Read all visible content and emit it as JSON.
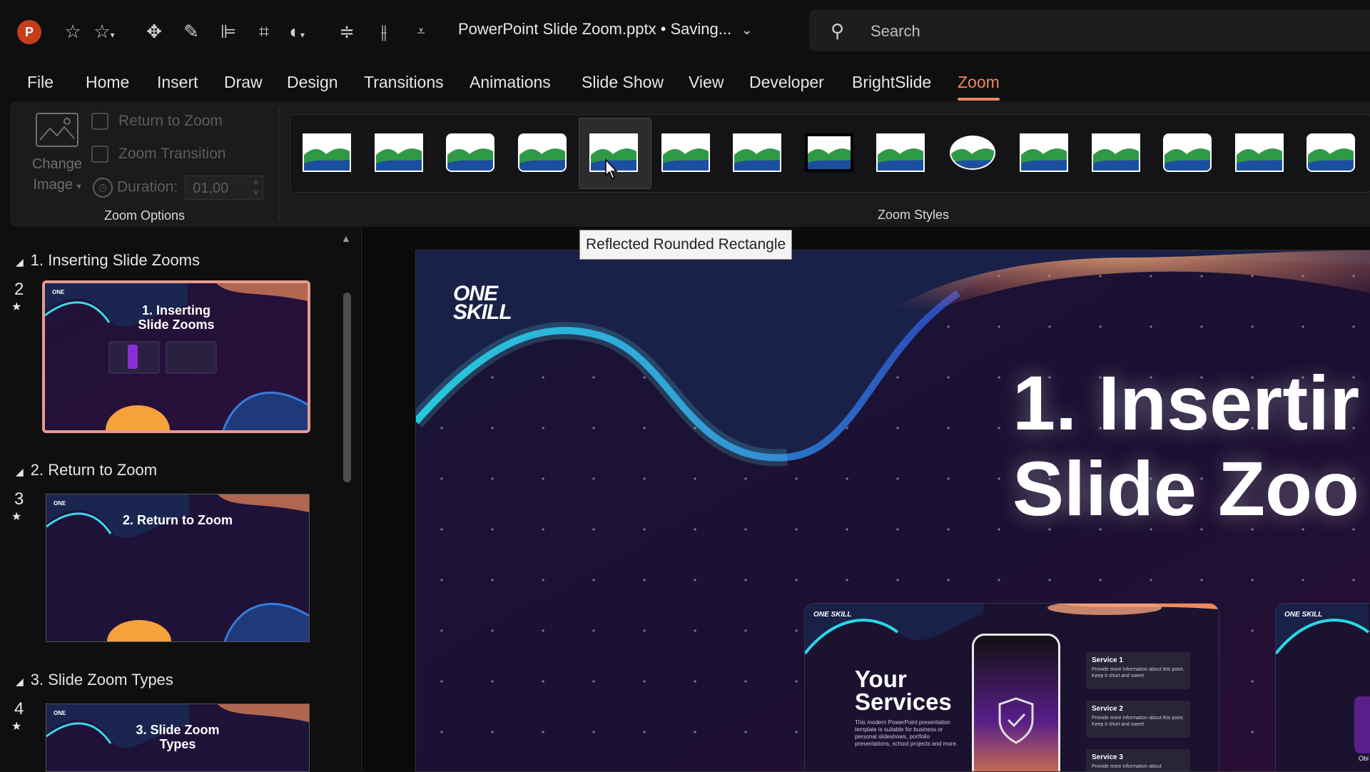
{
  "app": {
    "logo_letter": "P",
    "doc_title": "PowerPoint Slide Zoom.pptx • Saving...",
    "search_placeholder": "Search"
  },
  "quick_access_icons": [
    "auto-fit-icon",
    "star-icon",
    "move-icon",
    "stylus-icon",
    "align-icon",
    "crop-icon",
    "shape-icon",
    "distribute-horizontal-icon",
    "distribute-vertical-icon",
    "customize-icon"
  ],
  "tabs": [
    "File",
    "Home",
    "Insert",
    "Draw",
    "Design",
    "Transitions",
    "Animations",
    "Slide Show",
    "View",
    "Developer",
    "BrightSlide",
    "Zoom"
  ],
  "active_tab": "Zoom",
  "ribbon": {
    "change_image_label_1": "Change",
    "change_image_label_2": "Image",
    "return_to_zoom": "Return to Zoom",
    "zoom_transition": "Zoom Transition",
    "duration_label": "Duration:",
    "duration_value": "01,00",
    "zoom_options_label": "Zoom Options",
    "zoom_styles_label": "Zoom Styles",
    "style_count": 15,
    "hovered_style_index": 4
  },
  "tooltip": "Reflected Rounded Rectangle",
  "sections": [
    {
      "title": "1. Inserting Slide Zooms",
      "slide_number": "2",
      "thumb_title": "1. Inserting Slide Zooms",
      "selected": true
    },
    {
      "title": "2. Return to Zoom",
      "slide_number": "3",
      "thumb_title": "2. Return to Zoom",
      "selected": false
    },
    {
      "title": "3. Slide Zoom Types",
      "slide_number": "4",
      "thumb_title": "3. Slide Zoom Types",
      "selected": false
    }
  ],
  "slide": {
    "logo_line1": "ONE",
    "logo_line2": "SKILL",
    "title_line1": "1. Insertir",
    "title_line2": "Slide Zoo",
    "card": {
      "logo": "ONE SKILL",
      "title_line1": "Your",
      "title_line2": "Services",
      "description": "This modern PowerPoint presentation template is suitable for business or personal slideshows, portfolio presentations, school projects and more.",
      "services": [
        {
          "name": "Service 1",
          "desc": "Provide more information about this point. Keep it short and sweet"
        },
        {
          "name": "Service 2",
          "desc": "Provide more information about this point. Keep it short and sweet"
        },
        {
          "name": "Service 3",
          "desc": "Provide more information about"
        }
      ]
    },
    "card2_logo": "ONE SKILL",
    "card2_text": "Obi"
  },
  "colors": {
    "accent": "#f0885f",
    "selected_border": "#e79a8d",
    "app_red": "#c43e1c",
    "slide_bg": "#1a1033"
  }
}
